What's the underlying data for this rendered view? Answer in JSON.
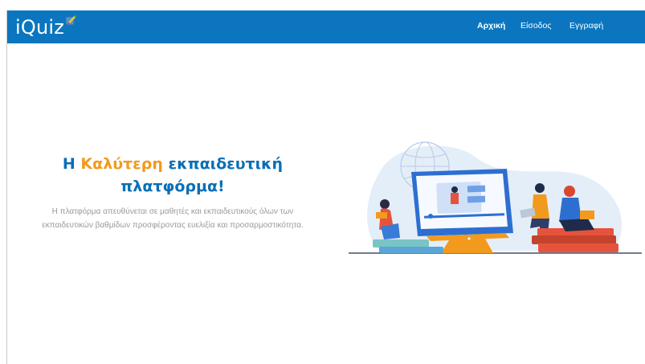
{
  "brand": {
    "name": "iQuiz",
    "logo_icon": "pencil-note-icon"
  },
  "nav": {
    "items": [
      {
        "label": "Αρχική",
        "active": true
      },
      {
        "label": "Είσοδος",
        "active": false
      },
      {
        "label": "Εγγραφή",
        "active": false
      }
    ]
  },
  "hero": {
    "title_pre": "Η ",
    "title_accent": "Καλύτερη",
    "title_post": " εκπαιδευτική πλατφόρμα!",
    "description": "Η πλατφόρμα απευθύνεται σε μαθητές και εκπαιδευτικούς όλων των εκπαιδευτικών βαθμίδων προσφέροντας ευελιξία και προσαρμοστικότητα."
  },
  "colors": {
    "navbar": "#0b76bf",
    "title_blue": "#0a6fb6",
    "title_orange": "#f29a1e",
    "description_gray": "#9a9a9a"
  }
}
